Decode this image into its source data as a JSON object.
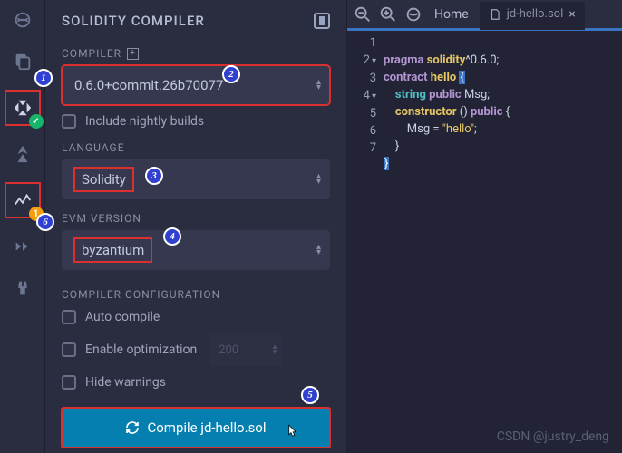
{
  "iconbar": {
    "badge_compile": "✓",
    "badge_analysis": "1"
  },
  "panel": {
    "title": "SOLIDITY COMPILER",
    "compiler_label": "COMPILER",
    "compiler_value": "0.6.0+commit.26b70077",
    "nightly_label": "Include nightly builds",
    "language_label": "LANGUAGE",
    "language_value": "Solidity",
    "evm_label": "EVM VERSION",
    "evm_value": "byzantium",
    "config_label": "COMPILER CONFIGURATION",
    "auto_compile_label": "Auto compile",
    "enable_opt_label": "Enable optimization",
    "opt_runs": "200",
    "hide_warnings_label": "Hide warnings",
    "compile_btn": "Compile jd-hello.sol"
  },
  "editor": {
    "home_label": "Home",
    "tab_name": "jd-hello.sol",
    "lines": [
      "1",
      "2",
      "3",
      "4",
      "5",
      "6",
      "7"
    ]
  },
  "code": {
    "pragma": "pragma",
    "solidity": "solidity",
    "ver": "^0.6.0",
    "contract": "contract",
    "hello": "hello",
    "string": "string",
    "public": "public",
    "Msg": "Msg",
    "constructor": "constructor",
    "stringlit": "\"hello\"",
    "assign": "Msg = "
  },
  "annotations": {
    "a1": "1",
    "a2": "2",
    "a3": "3",
    "a4": "4",
    "a5": "5",
    "a6": "6"
  },
  "watermark": "CSDN @justry_deng"
}
